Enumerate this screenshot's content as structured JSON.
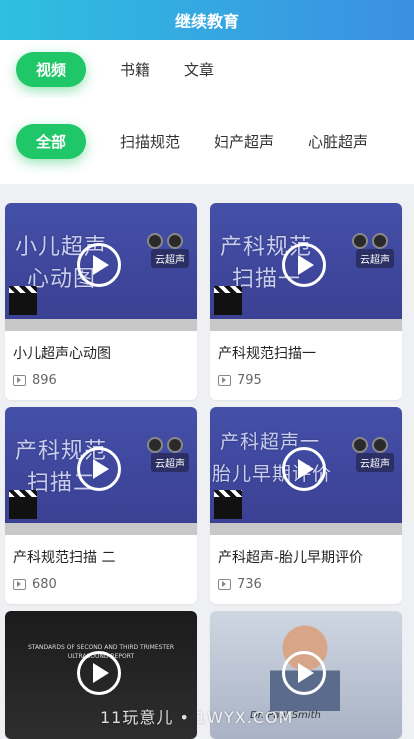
{
  "header": {
    "title": "继续教育"
  },
  "type_tabs": [
    {
      "label": "视频",
      "active": true
    },
    {
      "label": "书籍",
      "active": false
    },
    {
      "label": "文章",
      "active": false
    }
  ],
  "category_tabs": [
    {
      "label": "全部",
      "active": true
    },
    {
      "label": "扫描规范",
      "active": false
    },
    {
      "label": "妇产超声",
      "active": false
    },
    {
      "label": "心脏超声",
      "active": false
    }
  ],
  "videos": [
    {
      "title": "小儿超声心动图",
      "views": "896",
      "thumb_text": [
        "小儿超声",
        "心动图"
      ],
      "badge": "云超声"
    },
    {
      "title": "产科规范扫描一",
      "views": "795",
      "thumb_text": [
        "产科规范",
        "扫描一"
      ],
      "badge": "云超声"
    },
    {
      "title": "产科规范扫描 二",
      "views": "680",
      "thumb_text": [
        "产科规范",
        "扫描二"
      ],
      "badge": "云超声"
    },
    {
      "title": "产科超声-胎儿早期评价",
      "views": "736",
      "thumb_text": [
        "产科超声一",
        "胎儿早期评价"
      ],
      "badge": "云超声"
    },
    {
      "title": "",
      "views": "",
      "thumb_text": [
        "STANDARDS OF SECOND AND THIRD TRIMESTER",
        "ULTRASOUND REPORT"
      ],
      "badge": ""
    },
    {
      "title": "",
      "views": "",
      "thumb_text": [
        "Dr. Paul Smith"
      ],
      "badge": ""
    }
  ],
  "watermark": "11玩意儿 • 1WYX.COM",
  "colors": {
    "header_start": "#2ec0df",
    "header_end": "#3b8fe3",
    "active_tab": "#1fc768"
  }
}
